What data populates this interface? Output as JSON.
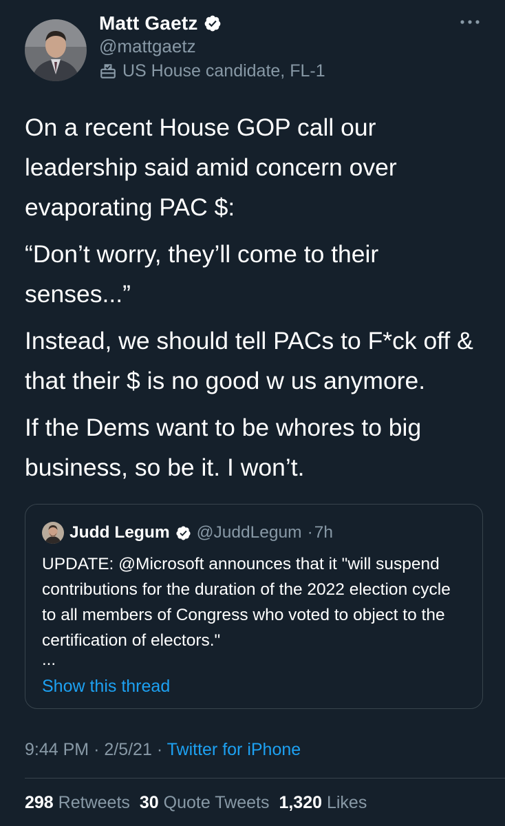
{
  "tweet": {
    "author": {
      "name": "Matt Gaetz",
      "handle": "@mattgaetz",
      "label": "US House candidate, FL-1",
      "verified": true
    },
    "paragraphs": [
      "On a recent House GOP call our leadership said amid concern over evaporating PAC $:",
      "“Don’t worry, they’ll come to their senses...”",
      "Instead, we should tell PACs to F*ck off & that their $ is no good w us anymore.",
      "If the Dems want to be whores to big business, so be it. I won’t."
    ],
    "quoted": {
      "name": "Judd Legum",
      "handle": "@JuddLegum",
      "separator": "·",
      "time": "7h",
      "text": "UPDATE: @Microsoft announces that it \"will suspend contributions for the duration of the 2022 election cycle to all members of Congress who voted to object to the certification of electors.\"",
      "ellipsis": "...",
      "show_thread": "Show this thread"
    },
    "time": "9:44 PM",
    "separator": "·",
    "date": "2/5/21",
    "source": "Twitter for iPhone",
    "stats": {
      "retweets_count": "298",
      "retweets_label": "Retweets",
      "quote_count": "30",
      "quote_label": "Quote Tweets",
      "likes_count": "1,320",
      "likes_label": "Likes"
    }
  },
  "colors": {
    "background": "#15202b",
    "text": "#ffffff",
    "secondary": "#8899a6",
    "accent": "#1da1f2",
    "border": "#38444d"
  },
  "icons": {
    "verified": "verified-badge-icon",
    "label": "ballot-box-icon",
    "more": "more-options-icon"
  }
}
